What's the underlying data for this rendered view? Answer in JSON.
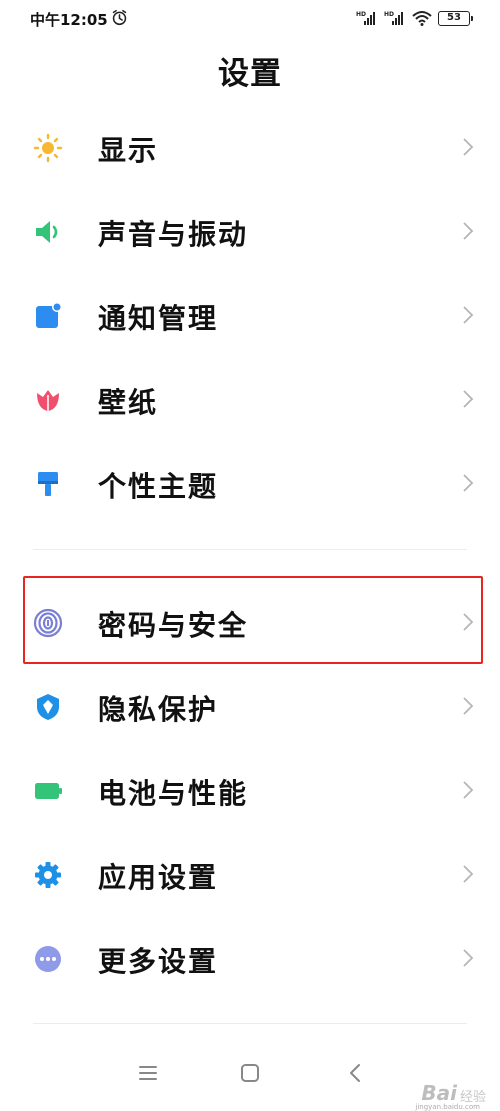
{
  "status_bar": {
    "time": "中午12:05",
    "network_badge": "HD",
    "battery": "53"
  },
  "header": {
    "title": "设置"
  },
  "settings": {
    "items": [
      {
        "label": "显示",
        "icon": "sun-icon",
        "color": "#f7b731"
      },
      {
        "label": "声音与振动",
        "icon": "speaker-icon",
        "color": "#33c47a"
      },
      {
        "label": "通知管理",
        "icon": "notification-icon",
        "color": "#2d8cf0"
      },
      {
        "label": "壁纸",
        "icon": "tulip-icon",
        "color": "#f0506e"
      },
      {
        "label": "个性主题",
        "icon": "paintbrush-icon",
        "color": "#2d8cf0"
      },
      {
        "label": "密码与安全",
        "icon": "fingerprint-icon",
        "color": "#7b7fd4"
      },
      {
        "label": "隐私保护",
        "icon": "shield-icon",
        "color": "#1e90e6"
      },
      {
        "label": "电池与性能",
        "icon": "battery-icon",
        "color": "#33c47a"
      },
      {
        "label": "应用设置",
        "icon": "gear-icon",
        "color": "#1e90e6"
      },
      {
        "label": "更多设置",
        "icon": "more-dots-icon",
        "color": "#8f9be8"
      }
    ]
  },
  "annotation": {
    "highlight_color": "#e8261f"
  },
  "watermark": {
    "logo": "Bai",
    "text": "经验",
    "url": "jingyan.baidu.com"
  }
}
